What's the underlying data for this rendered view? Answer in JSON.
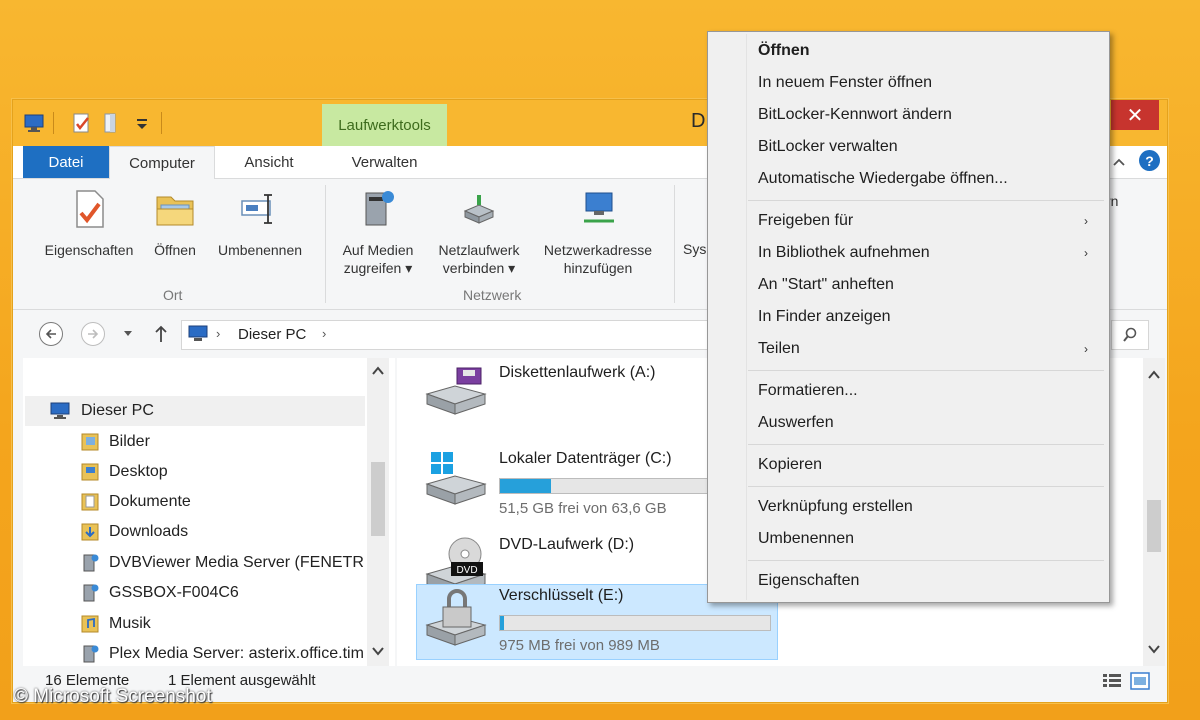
{
  "titlebar": {
    "contextual_tab": "Laufwerktools",
    "title_fragment": "D",
    "close_symbol": "✕"
  },
  "ribbon_tabs": [
    "Datei",
    "Computer",
    "Ansicht",
    "Verwalten"
  ],
  "ribbon": {
    "ort": {
      "label": "Ort",
      "buttons": [
        {
          "label": "Eigenschaften",
          "icon": "properties-icon"
        },
        {
          "label": "Öffnen",
          "icon": "open-folder-icon"
        },
        {
          "label": "Umbenennen",
          "icon": "rename-icon"
        }
      ]
    },
    "netzwerk": {
      "label": "Netzwerk",
      "buttons": [
        {
          "line1": "Auf Medien",
          "line2": "zugreifen ▾",
          "icon": "media-server-icon"
        },
        {
          "line1": "Netzlaufwerk",
          "line2": "verbinden ▾",
          "icon": "network-drive-icon"
        },
        {
          "line1": "Netzwerkadresse",
          "line2": "hinzufügen",
          "icon": "network-location-icon"
        }
      ]
    },
    "partial_left": "Sys",
    "partial_right": "rn"
  },
  "address": {
    "path": "Dieser PC",
    "separator": "›"
  },
  "nav_pane": {
    "root": "Dieser PC",
    "items": [
      {
        "label": "Bilder",
        "icon": "pictures-folder-icon"
      },
      {
        "label": "Desktop",
        "icon": "desktop-folder-icon"
      },
      {
        "label": "Dokumente",
        "icon": "documents-folder-icon"
      },
      {
        "label": "Downloads",
        "icon": "downloads-folder-icon"
      },
      {
        "label": "DVBViewer Media Server (FENETRIX",
        "icon": "media-server-icon"
      },
      {
        "label": "GSSBOX-F004C6",
        "icon": "media-server-icon"
      },
      {
        "label": "Musik",
        "icon": "music-folder-icon"
      },
      {
        "label": "Plex Media Server: asterix.office.tim",
        "icon": "media-server-icon"
      }
    ]
  },
  "drives": [
    {
      "name": "Diskettenlaufwerk (A:)",
      "icon": "floppy-drive-icon"
    },
    {
      "name": "Lokaler Datenträger (C:)",
      "icon": "windows-drive-icon",
      "info": "51,5 GB frei von 63,6 GB",
      "used_fraction": 0.19
    },
    {
      "name": "DVD-Laufwerk (D:)",
      "icon": "dvd-drive-icon",
      "badge": "DVD"
    },
    {
      "name": "Verschlüsselt (E:)",
      "icon": "locked-drive-icon",
      "info": "975 MB frei von 989 MB",
      "used_fraction": 0.014,
      "selected": true
    }
  ],
  "status": {
    "count": "16 Elemente",
    "selection": "1 Element ausgewählt"
  },
  "context_menu": {
    "items": [
      {
        "label": "Öffnen",
        "bold": true
      },
      {
        "label": "In neuem Fenster öffnen"
      },
      {
        "label": "BitLocker-Kennwort ändern"
      },
      {
        "label": "BitLocker verwalten"
      },
      {
        "label": "Automatische Wiedergabe öffnen..."
      },
      {
        "label": "Freigeben für",
        "submenu": true
      },
      {
        "label": "In Bibliothek aufnehmen",
        "submenu": true
      },
      {
        "label": "An \"Start\" anheften"
      },
      {
        "label": "In Finder anzeigen"
      },
      {
        "label": "Teilen",
        "submenu": true
      },
      {
        "label": "Formatieren..."
      },
      {
        "label": "Auswerfen"
      },
      {
        "label": "Kopieren"
      },
      {
        "label": "Verknüpfung erstellen"
      },
      {
        "label": "Umbenennen"
      },
      {
        "label": "Eigenschaften"
      }
    ],
    "submenu_arrow": "›"
  },
  "watermark": "© Microsoft Screenshot",
  "colors": {
    "desktop": "#f4a51d",
    "datei_tab": "#1e6fc2",
    "contextual_tab": "#c8e9a1",
    "close_button": "#c7342e",
    "drive_bar_fill": "#26a0da",
    "selection": "#cce8ff"
  }
}
